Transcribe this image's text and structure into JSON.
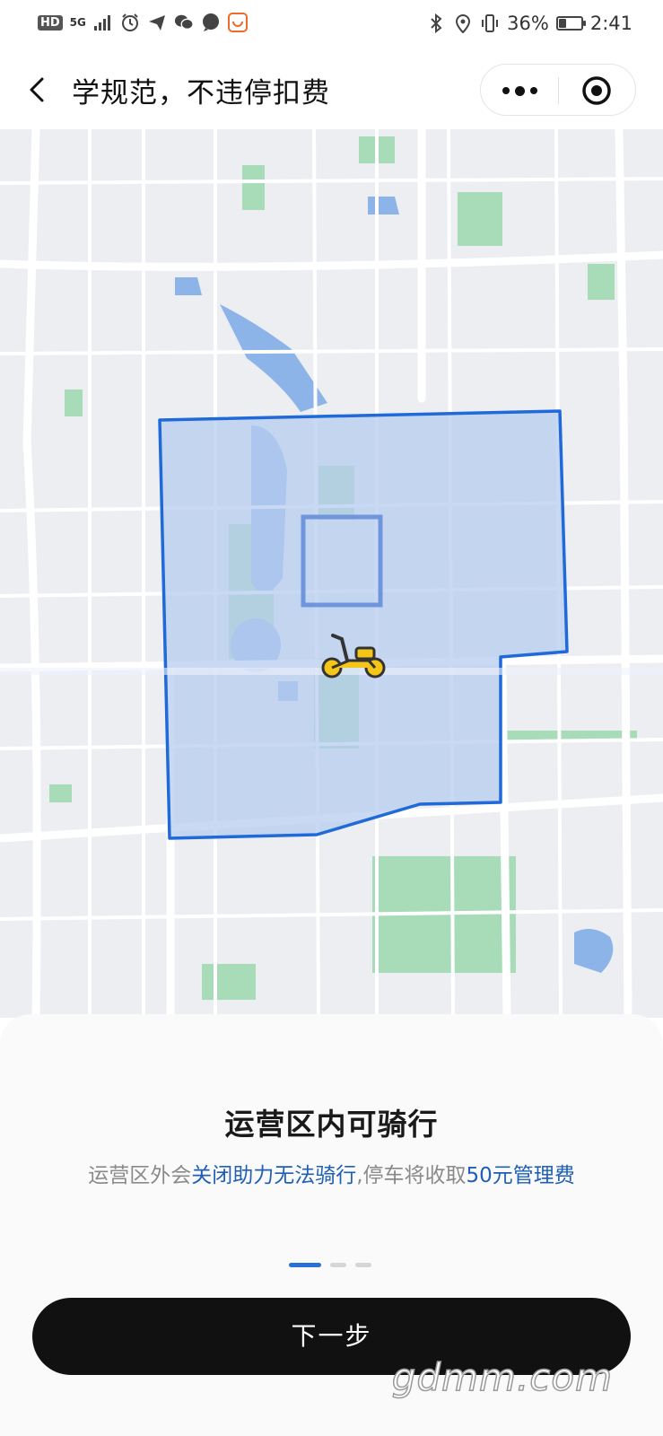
{
  "status_bar": {
    "left_badge": "HD",
    "network": "5G",
    "battery_percent": "36%",
    "battery_level": 0.36,
    "time": "2:41"
  },
  "nav": {
    "title": "学规范，不违停扣费"
  },
  "map": {
    "colors": {
      "background": "#eceef2",
      "road": "#ffffff",
      "park": "#a8dcb8",
      "water": "#8db4e8",
      "zone_fill": "#b7ccef",
      "zone_border": "#1f6ad8"
    },
    "marker_icon": "scooter-icon"
  },
  "sheet": {
    "title": "运营区内可骑行",
    "desc_part1": "运营区外会",
    "desc_highlight1": "关闭助力无法骑行",
    "desc_part2": ",停车将收取",
    "desc_highlight2": "50元管理费",
    "pager_total": 3,
    "pager_active": 1,
    "next_button": "下一步"
  },
  "watermark": "gdmm.com"
}
